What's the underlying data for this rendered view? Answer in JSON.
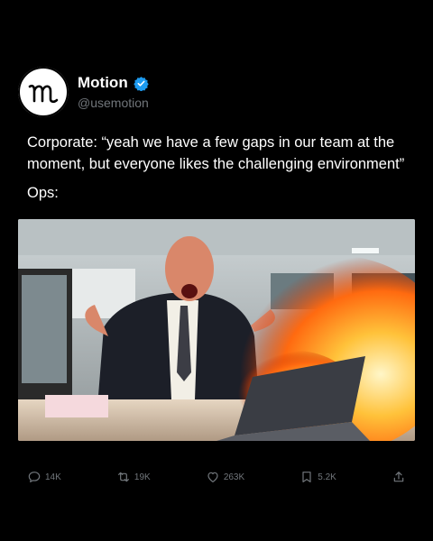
{
  "author": {
    "display_name": "Motion",
    "handle": "@usemotion",
    "verified": true,
    "avatar_icon": "motion-logo-icon",
    "verified_icon": "verified-badge-icon",
    "verified_color": "#1d9bf0"
  },
  "tweet": {
    "line1": "Corporate: “yeah we have a few gaps in our team at the moment, but everyone likes the challenging environment”",
    "line2": "Ops:"
  },
  "media": {
    "description_icon": "office-fire-photo"
  },
  "actions": {
    "replies": {
      "icon": "reply-icon",
      "count": "14K"
    },
    "reposts": {
      "icon": "repost-icon",
      "count": "19K"
    },
    "likes": {
      "icon": "heart-icon",
      "count": "263K"
    },
    "bookmarks": {
      "icon": "bookmark-icon",
      "count": "5.2K"
    },
    "share": {
      "icon": "share-icon"
    }
  },
  "colors": {
    "background": "#000000",
    "text": "#ffffff",
    "muted": "#71767b"
  }
}
